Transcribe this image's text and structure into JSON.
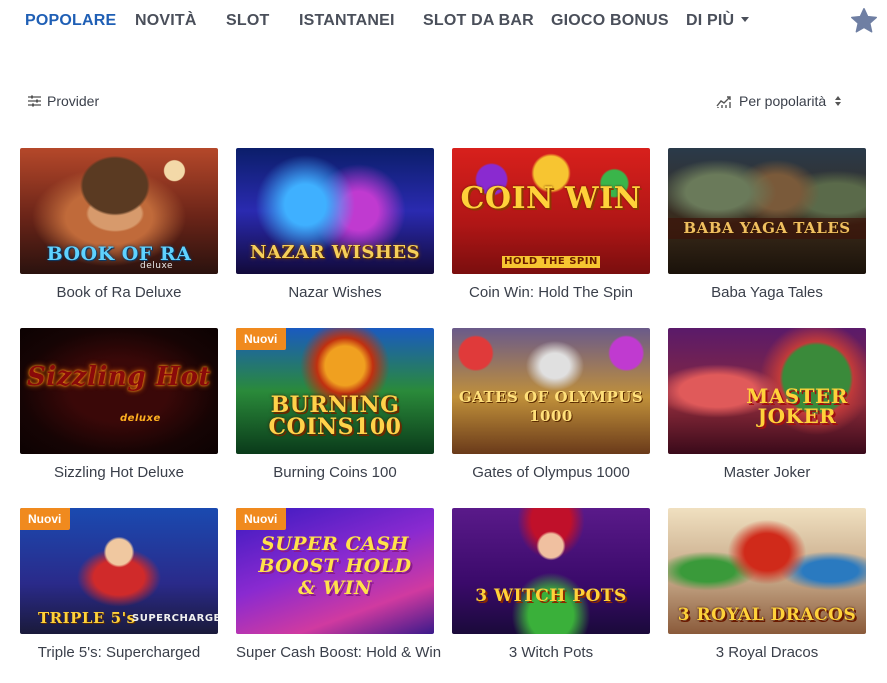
{
  "nav": {
    "tabs": [
      "POPOLARE",
      "NOVITÀ",
      "SLOT",
      "ISTANTANEI",
      "SLOT DA BAR",
      "GIOCO BONUS",
      "DI PIÙ"
    ],
    "active_tab": "POPOLARE",
    "favorites_icon": "star-icon"
  },
  "toolbar": {
    "provider_label": "Provider",
    "provider_icon": "filter-sliders-icon",
    "sort_label": "Per popolarità",
    "sort_icon": "trend-chart-icon"
  },
  "games": [
    {
      "title": "Book of Ra Deluxe",
      "badge": "",
      "logo": "BOOK OF RA",
      "logo_sub": "deluxe"
    },
    {
      "title": "Nazar Wishes",
      "badge": "",
      "logo": "NAZAR WISHES",
      "logo_sub": ""
    },
    {
      "title": "Coin Win: Hold The Spin",
      "badge": "",
      "logo": "COIN WIN",
      "logo_sub": "HOLD THE SPIN"
    },
    {
      "title": "Baba Yaga Tales",
      "badge": "",
      "logo": "BABA YAGA TALES",
      "logo_sub": ""
    },
    {
      "title": "Sizzling Hot Deluxe",
      "badge": "",
      "logo": "Sizzling Hot",
      "logo_sub": "deluxe"
    },
    {
      "title": "Burning Coins 100",
      "badge": "Nuovi",
      "logo": "BURNING COINS100",
      "logo_sub": ""
    },
    {
      "title": "Gates of Olympus 1000",
      "badge": "",
      "logo": "GATES OF OLYMPUS 1000",
      "logo_sub": ""
    },
    {
      "title": "Master Joker",
      "badge": "",
      "logo": "MASTER JOKER",
      "logo_sub": ""
    },
    {
      "title": "Triple 5's: Supercharged",
      "badge": "Nuovi",
      "logo": "TRIPLE 5's",
      "logo_sub": "SUPERCHARGED"
    },
    {
      "title": "Super Cash Boost: Hold & Win",
      "badge": "Nuovi",
      "logo": "SUPER CASH BOOST HOLD & WIN",
      "logo_sub": ""
    },
    {
      "title": "3 Witch Pots",
      "badge": "",
      "logo": "3 WITCH POTS",
      "logo_sub": ""
    },
    {
      "title": "3 Royal Dracos",
      "badge": "",
      "logo": "3 ROYAL DRACOS",
      "logo_sub": ""
    }
  ],
  "colors": {
    "accent": "#1f5fb5",
    "badge": "#f08a1e",
    "text": "#3a3f4a"
  }
}
